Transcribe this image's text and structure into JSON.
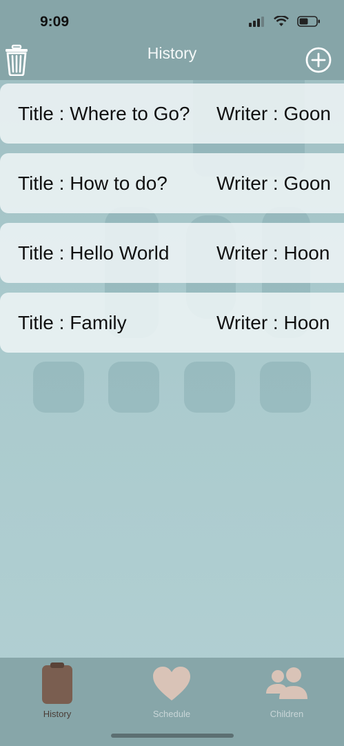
{
  "status": {
    "time": "9:09"
  },
  "nav": {
    "title": "History"
  },
  "rows": [
    {
      "title": "Title : Where to Go?",
      "writer": "Writer : Goon"
    },
    {
      "title": "Title : How to do?",
      "writer": "Writer : Goon"
    },
    {
      "title": "Title : Hello World",
      "writer": "Writer : Hoon"
    },
    {
      "title": "Title : Family",
      "writer": "Writer : Hoon"
    }
  ],
  "tabs": [
    {
      "label": "History",
      "icon": "clipboard-icon",
      "selected": true
    },
    {
      "label": "Schedule",
      "icon": "heart-icon",
      "selected": false
    },
    {
      "label": "Children",
      "icon": "people-icon",
      "selected": false
    }
  ],
  "colors": {
    "nav_bg": "#86a5a8",
    "row_bg": "#eff4f6",
    "tab_selected": "#7a5e50",
    "tab_unselected": "#d9c3b7"
  }
}
